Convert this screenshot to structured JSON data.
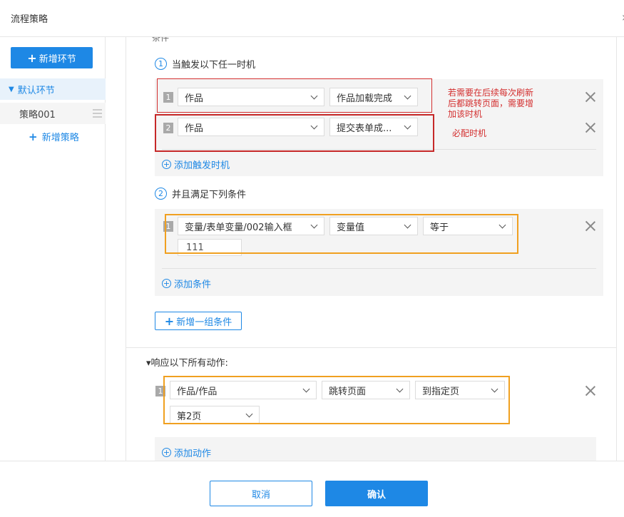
{
  "header": {
    "title": "流程策略",
    "close_glyph": "›"
  },
  "sidebar": {
    "add_node_label": "新增环节",
    "node_label": "默认环节",
    "policy_label": "策略001",
    "add_policy_label": "新增策略"
  },
  "content": {
    "cut_title": "条件",
    "step1": {
      "num": "1",
      "label": "当触发以下任一时机"
    },
    "triggers": [
      {
        "index": "1",
        "object": "作品",
        "event": "作品加载完成"
      },
      {
        "index": "2",
        "object": "作品",
        "event": "提交表单成..."
      }
    ],
    "add_trigger_label": "添加触发时机",
    "annotation_main": "若需要在后续每次刷新后都跳转页面，需要增加该时机",
    "annotation_sub": "必配时机",
    "step2": {
      "num": "2",
      "label": "并且满足下列条件"
    },
    "condition": {
      "index": "1",
      "variable": "变量/表单变量/002输入框",
      "value_type": "变量值",
      "operator": "等于",
      "value": "111"
    },
    "add_condition_label": "添加条件",
    "new_group_label": "新增一组条件",
    "response_title": "▾响应以下所有动作:",
    "action": {
      "index": "1",
      "target": "作品/作品",
      "action": "跳转页面",
      "mode": "到指定页",
      "page": "第2页"
    },
    "add_action_label": "添加动作"
  },
  "footer": {
    "cancel_label": "取消",
    "ok_label": "确认"
  },
  "colors": {
    "accent": "#1e88e5",
    "annotation_red": "#d32f2f",
    "highlight_orange": "#f0a020"
  }
}
